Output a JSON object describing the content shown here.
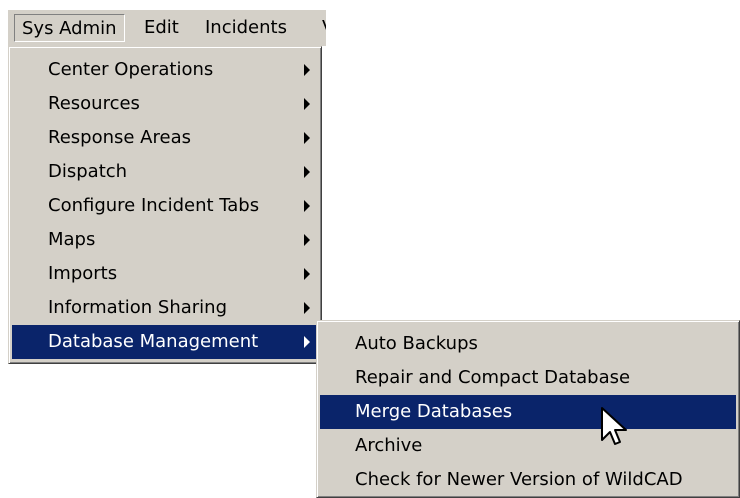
{
  "menubar": {
    "items": [
      {
        "label": "Sys Admin"
      },
      {
        "label": "Edit"
      },
      {
        "label": "Incidents"
      },
      {
        "label": "V"
      }
    ]
  },
  "sys_admin_menu": {
    "items": [
      {
        "label": "Center Operations"
      },
      {
        "label": "Resources"
      },
      {
        "label": "Response Areas"
      },
      {
        "label": "Dispatch"
      },
      {
        "label": "Configure Incident Tabs"
      },
      {
        "label": "Maps"
      },
      {
        "label": "Imports"
      },
      {
        "label": "Information Sharing"
      },
      {
        "label": "Database Management"
      }
    ]
  },
  "database_management_menu": {
    "items": [
      {
        "label": "Auto Backups"
      },
      {
        "label": "Repair and Compact Database"
      },
      {
        "label": "Merge Databases"
      },
      {
        "label": "Archive"
      },
      {
        "label": "Check for Newer Version of WildCAD"
      }
    ]
  },
  "colors": {
    "menu_bg": "#d4d0c8",
    "highlight_bg": "#0a246a",
    "highlight_text": "#ffffff"
  },
  "icons": {
    "submenu": "chevron-right-icon",
    "pointer": "mouse-cursor-icon"
  }
}
